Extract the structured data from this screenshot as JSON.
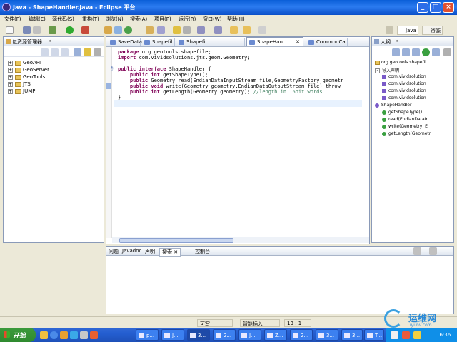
{
  "window": {
    "title": "Java - ShapeHandler.java - Eclipse 平台",
    "minimize": "_",
    "maximize": "□",
    "close": "×"
  },
  "menu": [
    "文件(F)",
    "编辑(E)",
    "源代码(S)",
    "重构(T)",
    "浏览(N)",
    "搜索(A)",
    "项目(P)",
    "运行(R)",
    "窗口(W)",
    "帮助(H)"
  ],
  "perspectives": [
    "Java",
    "资源"
  ],
  "package_explorer": {
    "title": "包资源管理器",
    "items": [
      "GeoAPI",
      "GeoServer",
      "GeoTools",
      "JTS",
      "JUMP"
    ]
  },
  "editor": {
    "tabs": [
      "SaveData...",
      "Shapefil...",
      "Shapefil...",
      "ShapeHan...",
      "CommonCa..."
    ],
    "active_tab": 3,
    "lines": [
      {
        "kw": "package",
        "rest": " org.geotools.shapefile;"
      },
      {
        "kw": "import",
        "rest": " com.vividsolutions.jts.geom.Geometry;"
      },
      {
        "kw": "",
        "rest": ""
      },
      {
        "kw": "public interface",
        "rest": " ShapeHandler {"
      },
      {
        "kw": "    public int",
        "rest": " getShapeType();"
      },
      {
        "kw": "    public",
        "rest": " Geometry read(EndianDataInputStream file,GeometryFactory geometr"
      },
      {
        "kw": "    public void",
        "rest": " write(Geometry geometry,EndianDataOutputStream file) throw"
      },
      {
        "kw": "    public int",
        "rest": " getLength(Geometry geometry); ",
        "cm": "//length in 16bit words"
      },
      {
        "kw": "",
        "rest": "}"
      }
    ]
  },
  "outline": {
    "title": "大纲",
    "items": [
      "org.geotools.shapefil",
      "导入声明",
      "com.vividsolution",
      "com.vividsolution",
      "com.vividsolution",
      "com.vividsolution",
      "ShapeHandler",
      "getShapeType()",
      "read(EndianDataIn",
      "write(Geometry, E",
      "getLength(Geometr"
    ]
  },
  "bottom_tabs": [
    "问题",
    "Javadoc",
    "声明",
    "搜索",
    "控制台"
  ],
  "status": {
    "writable": "可写",
    "insert": "智能插入",
    "position": "13 : 1"
  },
  "taskbar": {
    "start": "开始",
    "tasks": [
      "p...",
      "J...",
      "3...",
      "2...",
      "J...",
      "Z...",
      "2...",
      "3...",
      "3...",
      "3...",
      "T..."
    ],
    "clock": "16:36"
  },
  "watermark": {
    "text": "运维网",
    "subtext": "iyunv.com"
  }
}
